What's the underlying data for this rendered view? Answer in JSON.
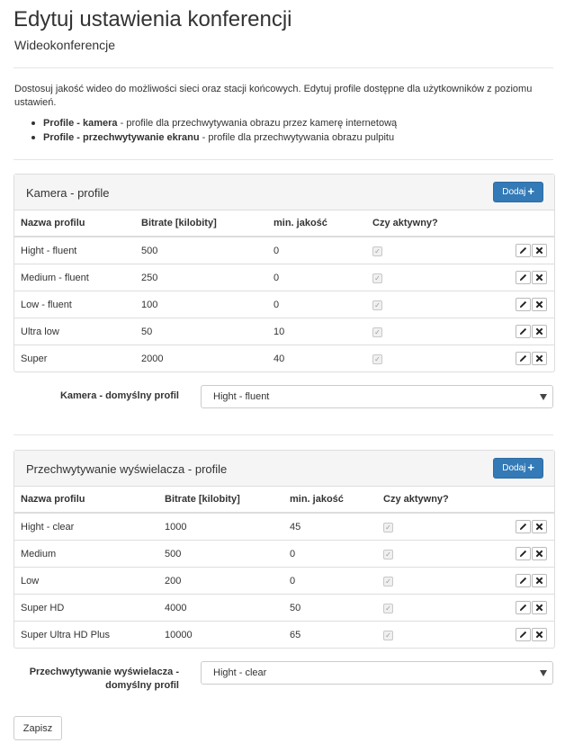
{
  "page": {
    "title": "Edytuj ustawienia konferencji",
    "subtitle": "Wideokonferencje",
    "description": "Dostosuj jakość wideo do możliwości sieci oraz stacji końcowych. Edytuj profile dostępne dla użytkowników z poziomu ustawień.",
    "bullets": [
      {
        "bold": "Profile - kamera",
        "text": " - profile dla przechwytywania obrazu przez kamerę internetową"
      },
      {
        "bold": "Profile - przechwytywanie ekranu",
        "text": " - profile dla przechwytywania obrazu pulpitu"
      }
    ]
  },
  "camera": {
    "title": "Kamera - profile",
    "add_label": "Dodaj",
    "columns": [
      "Nazwa profilu",
      "Bitrate [kilobity]",
      "min. jakość",
      "Czy aktywny?"
    ],
    "rows": [
      {
        "name": "Hight - fluent",
        "bitrate": "500",
        "quality": "0",
        "active": true
      },
      {
        "name": "Medium - fluent",
        "bitrate": "250",
        "quality": "0",
        "active": true
      },
      {
        "name": "Low - fluent",
        "bitrate": "100",
        "quality": "0",
        "active": true
      },
      {
        "name": "Ultra low",
        "bitrate": "50",
        "quality": "10",
        "active": true
      },
      {
        "name": "Super",
        "bitrate": "2000",
        "quality": "40",
        "active": true
      }
    ],
    "default_label": "Kamera - domyślny profil",
    "default_value": "Hight - fluent"
  },
  "screen": {
    "title": "Przechwytywanie wyświelacza - profile",
    "add_label": "Dodaj",
    "columns": [
      "Nazwa profilu",
      "Bitrate [kilobity]",
      "min. jakość",
      "Czy aktywny?"
    ],
    "rows": [
      {
        "name": "Hight - clear",
        "bitrate": "1000",
        "quality": "45",
        "active": true
      },
      {
        "name": "Medium",
        "bitrate": "500",
        "quality": "0",
        "active": true
      },
      {
        "name": "Low",
        "bitrate": "200",
        "quality": "0",
        "active": true
      },
      {
        "name": "Super HD",
        "bitrate": "4000",
        "quality": "50",
        "active": true
      },
      {
        "name": "Super Ultra HD Plus",
        "bitrate": "10000",
        "quality": "65",
        "active": true
      }
    ],
    "default_label_line1": "Przechwytywanie wyświelacza -",
    "default_label_line2": "domyślny profil",
    "default_value": "Hight - clear"
  },
  "footer": {
    "save_label": "Zapisz"
  },
  "colors": {
    "primary": "#337ab7",
    "border": "#dddddd",
    "panel_head": "#f5f5f5",
    "text": "#333333"
  }
}
